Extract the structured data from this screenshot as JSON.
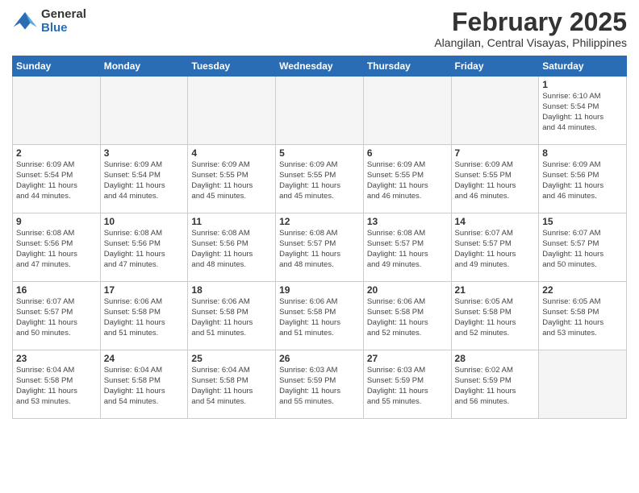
{
  "header": {
    "logo_general": "General",
    "logo_blue": "Blue",
    "month_title": "February 2025",
    "location": "Alangilan, Central Visayas, Philippines"
  },
  "days_of_week": [
    "Sunday",
    "Monday",
    "Tuesday",
    "Wednesday",
    "Thursday",
    "Friday",
    "Saturday"
  ],
  "weeks": [
    [
      {
        "day": "",
        "info": ""
      },
      {
        "day": "",
        "info": ""
      },
      {
        "day": "",
        "info": ""
      },
      {
        "day": "",
        "info": ""
      },
      {
        "day": "",
        "info": ""
      },
      {
        "day": "",
        "info": ""
      },
      {
        "day": "1",
        "info": "Sunrise: 6:10 AM\nSunset: 5:54 PM\nDaylight: 11 hours\nand 44 minutes."
      }
    ],
    [
      {
        "day": "2",
        "info": "Sunrise: 6:09 AM\nSunset: 5:54 PM\nDaylight: 11 hours\nand 44 minutes."
      },
      {
        "day": "3",
        "info": "Sunrise: 6:09 AM\nSunset: 5:54 PM\nDaylight: 11 hours\nand 44 minutes."
      },
      {
        "day": "4",
        "info": "Sunrise: 6:09 AM\nSunset: 5:55 PM\nDaylight: 11 hours\nand 45 minutes."
      },
      {
        "day": "5",
        "info": "Sunrise: 6:09 AM\nSunset: 5:55 PM\nDaylight: 11 hours\nand 45 minutes."
      },
      {
        "day": "6",
        "info": "Sunrise: 6:09 AM\nSunset: 5:55 PM\nDaylight: 11 hours\nand 46 minutes."
      },
      {
        "day": "7",
        "info": "Sunrise: 6:09 AM\nSunset: 5:55 PM\nDaylight: 11 hours\nand 46 minutes."
      },
      {
        "day": "8",
        "info": "Sunrise: 6:09 AM\nSunset: 5:56 PM\nDaylight: 11 hours\nand 46 minutes."
      }
    ],
    [
      {
        "day": "9",
        "info": "Sunrise: 6:08 AM\nSunset: 5:56 PM\nDaylight: 11 hours\nand 47 minutes."
      },
      {
        "day": "10",
        "info": "Sunrise: 6:08 AM\nSunset: 5:56 PM\nDaylight: 11 hours\nand 47 minutes."
      },
      {
        "day": "11",
        "info": "Sunrise: 6:08 AM\nSunset: 5:56 PM\nDaylight: 11 hours\nand 48 minutes."
      },
      {
        "day": "12",
        "info": "Sunrise: 6:08 AM\nSunset: 5:57 PM\nDaylight: 11 hours\nand 48 minutes."
      },
      {
        "day": "13",
        "info": "Sunrise: 6:08 AM\nSunset: 5:57 PM\nDaylight: 11 hours\nand 49 minutes."
      },
      {
        "day": "14",
        "info": "Sunrise: 6:07 AM\nSunset: 5:57 PM\nDaylight: 11 hours\nand 49 minutes."
      },
      {
        "day": "15",
        "info": "Sunrise: 6:07 AM\nSunset: 5:57 PM\nDaylight: 11 hours\nand 50 minutes."
      }
    ],
    [
      {
        "day": "16",
        "info": "Sunrise: 6:07 AM\nSunset: 5:57 PM\nDaylight: 11 hours\nand 50 minutes."
      },
      {
        "day": "17",
        "info": "Sunrise: 6:06 AM\nSunset: 5:58 PM\nDaylight: 11 hours\nand 51 minutes."
      },
      {
        "day": "18",
        "info": "Sunrise: 6:06 AM\nSunset: 5:58 PM\nDaylight: 11 hours\nand 51 minutes."
      },
      {
        "day": "19",
        "info": "Sunrise: 6:06 AM\nSunset: 5:58 PM\nDaylight: 11 hours\nand 51 minutes."
      },
      {
        "day": "20",
        "info": "Sunrise: 6:06 AM\nSunset: 5:58 PM\nDaylight: 11 hours\nand 52 minutes."
      },
      {
        "day": "21",
        "info": "Sunrise: 6:05 AM\nSunset: 5:58 PM\nDaylight: 11 hours\nand 52 minutes."
      },
      {
        "day": "22",
        "info": "Sunrise: 6:05 AM\nSunset: 5:58 PM\nDaylight: 11 hours\nand 53 minutes."
      }
    ],
    [
      {
        "day": "23",
        "info": "Sunrise: 6:04 AM\nSunset: 5:58 PM\nDaylight: 11 hours\nand 53 minutes."
      },
      {
        "day": "24",
        "info": "Sunrise: 6:04 AM\nSunset: 5:58 PM\nDaylight: 11 hours\nand 54 minutes."
      },
      {
        "day": "25",
        "info": "Sunrise: 6:04 AM\nSunset: 5:58 PM\nDaylight: 11 hours\nand 54 minutes."
      },
      {
        "day": "26",
        "info": "Sunrise: 6:03 AM\nSunset: 5:59 PM\nDaylight: 11 hours\nand 55 minutes."
      },
      {
        "day": "27",
        "info": "Sunrise: 6:03 AM\nSunset: 5:59 PM\nDaylight: 11 hours\nand 55 minutes."
      },
      {
        "day": "28",
        "info": "Sunrise: 6:02 AM\nSunset: 5:59 PM\nDaylight: 11 hours\nand 56 minutes."
      },
      {
        "day": "",
        "info": ""
      }
    ]
  ]
}
